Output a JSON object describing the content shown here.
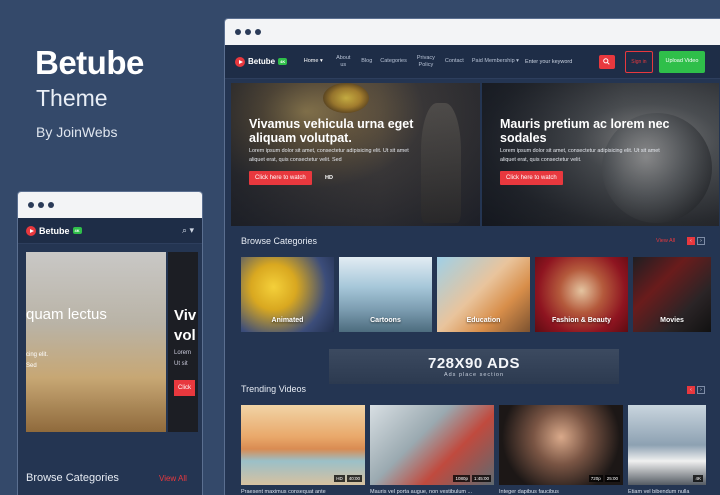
{
  "promo": {
    "title": "Betube",
    "subtitle": "Theme",
    "author": "By JoinWebs"
  },
  "brand": {
    "name": "Betube",
    "badge": "4K",
    "accent": "#e8383e",
    "green": "#2fbf4a"
  },
  "desktop": {
    "nav": {
      "links": [
        "Home",
        "About us",
        "Blog",
        "Categories",
        "Privacy Policy",
        "Contact",
        "Paid Membership"
      ],
      "search_placeholder": "Enter your keyword",
      "sign_in": "Sign in",
      "upload": "Upload Video"
    },
    "hero": [
      {
        "title": "Vivamus vehicula urna eget aliquam volutpat.",
        "text": "Lorem ipsum dolor sit amet, consectetur adipisicing elit. Ut sit amet aliquet erat, quis consectetur velit. Sed",
        "button": "Click here to watch",
        "quality": "HD"
      },
      {
        "title": "Mauris pretium ac lorem nec sodales",
        "text": "Lorem ipsum dolor sit amet, consectetur adipisicing elit. Ut sit amet aliquet erat, quis consectetur velit.",
        "button": "Click here to watch"
      }
    ],
    "browse": {
      "title": "Browse Categories",
      "view_all": "View All",
      "categories": [
        "Animated",
        "Cartoons",
        "Education",
        "Fashion & Beauty",
        "Movies"
      ]
    },
    "ads": {
      "title": "728X90 ADS",
      "subtitle": "Ads place section"
    },
    "trending": {
      "title": "Trending Videos",
      "videos": [
        {
          "caption": "Praesent maximus consequat ante",
          "tags": [
            "HD",
            "40:00"
          ]
        },
        {
          "caption": "Mauris vel porta augue, non vestibulum ...",
          "tags": [
            "1080p",
            "1:45:00"
          ]
        },
        {
          "caption": "Integer dapibus faucibus",
          "tags": [
            "720p",
            "25:00"
          ]
        },
        {
          "caption": "Etiam vel bibendum nulla",
          "tags": [
            "4K"
          ]
        }
      ]
    }
  },
  "mobile": {
    "hero": [
      {
        "title": "quam lectus",
        "text": "cing elit.\nSed"
      },
      {
        "title": "Viv\nvol",
        "text": "Lorem\nUt sit",
        "button": "Click"
      }
    ],
    "browse_title": "Browse Categories",
    "view_all": "View All"
  }
}
